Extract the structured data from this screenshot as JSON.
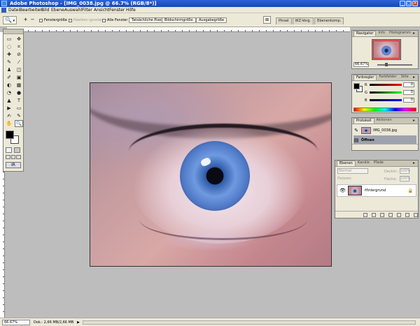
{
  "window": {
    "title": "Adobe Photoshop - [IMG_0038.jpg @ 66.7% (RGB/8*)]",
    "minimize": "_",
    "maximize": "□",
    "close": "×"
  },
  "menu": [
    "Datei",
    "Bearbeiten",
    "Bild",
    "Ebene",
    "Auswahl",
    "Filter",
    "Ansicht",
    "Fenster",
    "Hilfe"
  ],
  "options_bar": {
    "tool_icon": "zoom-tool-icon",
    "zoom_in": "+",
    "zoom_out": "−",
    "checkboxes": [
      {
        "label": "Fenstergröße",
        "checked": false,
        "enabled": true
      },
      {
        "label": "Paletten ignorieren",
        "checked": false,
        "enabled": false
      },
      {
        "label": "Alle Fenster",
        "checked": false,
        "enabled": true
      }
    ],
    "buttons": [
      "Tatsächliche Pixel",
      "Bildschirmgröße",
      "Ausgabegröße"
    ],
    "palette_well_tabs": [
      "Pinsel",
      "WZ-Vorg.",
      "Ebenenkomp."
    ]
  },
  "toolbox": {
    "tools": [
      "▭",
      "✥",
      "◌",
      "⌗",
      "✚",
      "⊘",
      "✎",
      "⁄",
      "♟",
      "◫",
      "✐",
      "▣",
      "◐",
      "▦",
      "◔",
      "●",
      "▲",
      "T",
      "▶",
      "▭",
      "✍",
      "✎",
      "✋",
      "🔍"
    ],
    "foreground": "#000000",
    "background": "#ffffff",
    "jump_to": "IR"
  },
  "navigator": {
    "tabs": [
      "Navigator",
      "Info",
      "Histogramm"
    ],
    "zoom": "66.67%"
  },
  "color_panel": {
    "tabs": [
      "Farbregler",
      "Farbfelder",
      "Stile"
    ],
    "channels": [
      {
        "label": "R",
        "value": "0",
        "gradient": "linear-gradient(to right,#000,#f00)"
      },
      {
        "label": "G",
        "value": "0",
        "gradient": "linear-gradient(to right,#000,#0f0)"
      },
      {
        "label": "B",
        "value": "0",
        "gradient": "linear-gradient(to right,#000,#00f)"
      }
    ]
  },
  "history": {
    "tabs": [
      "Protokoll",
      "Aktionen"
    ],
    "items": [
      {
        "label": "IMG_0038.jpg",
        "type": "snapshot"
      },
      {
        "label": "Öffnen",
        "type": "step",
        "selected": true
      }
    ]
  },
  "layers": {
    "tabs": [
      "Ebenen",
      "Kanäle",
      "Pfade"
    ],
    "blend_mode": "Normal",
    "opacity_label": "Deckkr.:",
    "opacity": "100%",
    "fill_label": "Fläche:",
    "fill": "100%",
    "lock_label": "Fixieren:",
    "rows": [
      {
        "name": "Hintergrund",
        "visible": true,
        "locked": true
      }
    ]
  },
  "status": {
    "zoom": "66.67%",
    "doc": "Dok.: 2,66 MB/2,66 MB",
    "arrow": "▶"
  }
}
